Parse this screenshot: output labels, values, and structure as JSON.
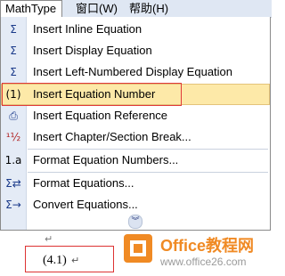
{
  "menubar": {
    "items": [
      {
        "label": "MathType"
      },
      {
        "label": "窗口(W)"
      },
      {
        "label": "帮助(H)"
      }
    ]
  },
  "menu": {
    "items": [
      {
        "icon": "sigma-inline-icon",
        "glyph": "Σ",
        "label": "Insert Inline Equation"
      },
      {
        "icon": "sigma-display-icon",
        "glyph": "Σ",
        "label": "Insert Display Equation"
      },
      {
        "icon": "sigma-left-numbered-icon",
        "glyph": "Σ",
        "label": "Insert Left-Numbered Display Equation"
      },
      {
        "icon": "equation-number-icon",
        "glyph": "(1)",
        "label": "Insert Equation Number"
      },
      {
        "icon": "equation-reference-icon",
        "glyph": "⎙",
        "label": "Insert Equation Reference"
      },
      {
        "icon": "chapter-break-icon",
        "glyph": "¹½",
        "label": "Insert Chapter/Section Break..."
      },
      {
        "icon": "format-numbers-icon",
        "glyph": "1.a",
        "label": "Format Equation Numbers..."
      },
      {
        "icon": "format-equations-icon",
        "glyph": "Σ⇄",
        "label": "Format Equations..."
      },
      {
        "icon": "convert-equations-icon",
        "glyph": "Σ→",
        "label": "Convert Equations..."
      }
    ],
    "highlighted_index": 3,
    "more_glyph": "︾"
  },
  "document": {
    "paragraph_mark": "↵",
    "equation_number": "(4.1)",
    "cursor_mark": "↵"
  },
  "watermark": {
    "line1": "Office教程网",
    "line2": "www.office26.com",
    "accent": "#f08a24"
  }
}
